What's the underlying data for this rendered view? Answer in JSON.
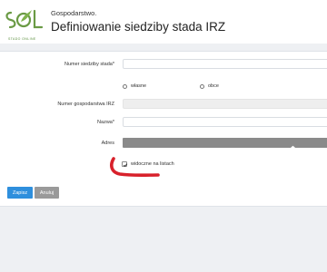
{
  "header": {
    "logo_text": "SOL",
    "logo_subtitle": "STADO ONLINE",
    "breadcrumb": "Gospodarstwo.",
    "title": "Definiowanie siedziby stada IRZ"
  },
  "form": {
    "herd_number_label": "Numer siedziby stada",
    "ownership_options": [
      "własne",
      "obce"
    ],
    "farm_number_label": "Numer gospodarstwa IRZ",
    "name_label": "Nazwa",
    "address_label": "Adres",
    "visible_checkbox_label": "widoczne na listach",
    "visible_checked": true,
    "required_mark": "*"
  },
  "actions": {
    "save_label": "Zapisz",
    "cancel_label": "Anuluj"
  },
  "colors": {
    "primary": "#2e8fdd",
    "secondary": "#9a9a9a",
    "address_button": "#8a8a8a",
    "annotation": "#d8212b",
    "logo_green": "#5a8f3c"
  }
}
